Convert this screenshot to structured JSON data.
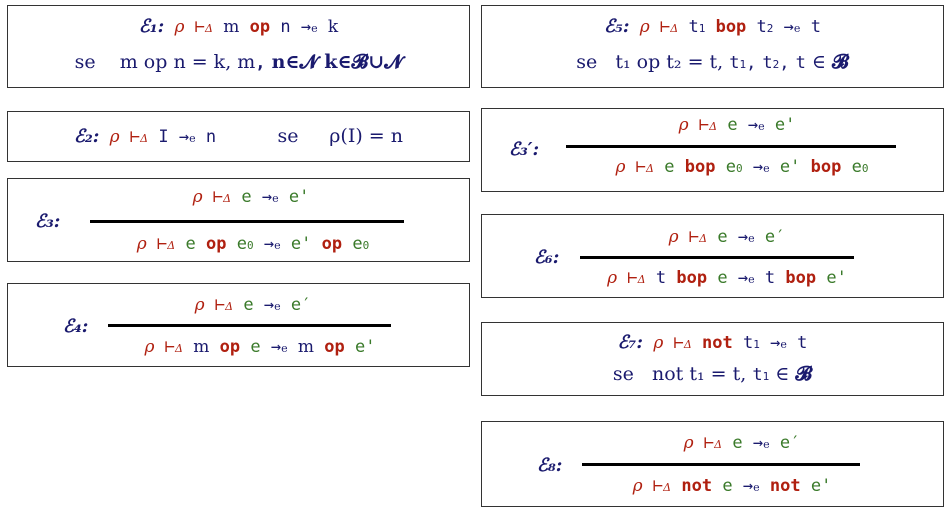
{
  "rules": {
    "e1": {
      "label": "ℰ₁:",
      "line1": {
        "rho": "ρ",
        "turnstile": "⊢",
        "delta": "Δ",
        "m": "m",
        "op": "op",
        "n": "n",
        "arrow": "→",
        "e": "e",
        "k": "k"
      },
      "line2": {
        "se": "se",
        "cond": "m op n = k, m",
        "comma": ",",
        "tail": "n∈𝓝  k∈𝓑∪𝓝"
      }
    },
    "e2": {
      "label": "ℰ₂:",
      "rho": "ρ",
      "turnstile": "⊢",
      "delta": "Δ",
      "I": "I",
      "arrow": "→",
      "e": "e",
      "n": "n",
      "se": "se",
      "cond": "ρ(I) = n"
    },
    "e3": {
      "label": "ℰ₃:",
      "premise": {
        "rho": "ρ",
        "turnstile": "⊢",
        "delta": "Δ",
        "e1": "e",
        "arrow": "→",
        "e": "e",
        "e2": "e'"
      },
      "concl": {
        "rho": "ρ",
        "turnstile": "⊢",
        "delta": "Δ",
        "e1": "e",
        "op": "op",
        "e0": "e",
        "zero": "0",
        "arrow": "→",
        "e": "e",
        "e2": "e'",
        "op2": "op",
        "e3": "e",
        "zero2": "0"
      }
    },
    "e4": {
      "label": "ℰ₄:",
      "premise": {
        "rho": "ρ",
        "turnstile": "⊢",
        "delta": "Δ",
        "e1": "e",
        "arrow": "→",
        "e": "e",
        "e2": "e′"
      },
      "concl": {
        "rho": "ρ",
        "turnstile": "⊢",
        "delta": "Δ",
        "m": "m",
        "op": "op",
        "e1": "e",
        "arrow": "→",
        "e": "e",
        "m2": "m",
        "op2": "op",
        "e2": "e'"
      }
    },
    "e5": {
      "label": "ℰ₅:",
      "line1": {
        "rho": "ρ",
        "turnstile": "⊢",
        "delta": "Δ",
        "t1": "t",
        "one": "1",
        "bop": "bop",
        "t2": "t",
        "two": "2",
        "arrow": "→",
        "e": "e",
        "t": "t"
      },
      "line2": {
        "se": "se",
        "cond": "t₁ op t₂ = t, ",
        "t1": "t",
        "one": "1",
        "c1": ",",
        "t2": "t",
        "two": "2",
        "c2": ",",
        "t": "t",
        "in": "∈",
        "B": "𝓑"
      }
    },
    "e3p": {
      "label": "ℰ₃′:",
      "premise": {
        "rho": "ρ",
        "turnstile": "⊢",
        "delta": "Δ",
        "e1": "e",
        "arrow": "→",
        "e": "e",
        "e2": "e'"
      },
      "concl": {
        "rho": "ρ",
        "turnstile": "⊢",
        "delta": "Δ",
        "e1": "e",
        "bop": "bop",
        "e0": "e",
        "zero": "0",
        "arrow": "→",
        "e": "e",
        "e2": "e'",
        "bop2": "bop",
        "e3": "e",
        "zero2": "0"
      }
    },
    "e6": {
      "label": "ℰ₆:",
      "premise": {
        "rho": "ρ",
        "turnstile": "⊢",
        "delta": "Δ",
        "e1": "e",
        "arrow": "→",
        "e": "e",
        "e2": "e′"
      },
      "concl": {
        "rho": "ρ",
        "turnstile": "⊢",
        "delta": "Δ",
        "t": "t",
        "bop": "bop",
        "e1": "e",
        "arrow": "→",
        "e": "e",
        "t2": "t",
        "bop2": "bop",
        "e2": "e'"
      }
    },
    "e7": {
      "label": "ℰ₇:",
      "line1": {
        "rho": "ρ",
        "turnstile": "⊢",
        "delta": "Δ",
        "not": "not",
        "t1": "t",
        "one": "1",
        "arrow": "→",
        "e": "e",
        "t": "t"
      },
      "line2": {
        "se": "se",
        "cond": "not t₁ = t, ",
        "t1": "t",
        "one": "1",
        "in": "∈",
        "B": "𝓑"
      }
    },
    "e8": {
      "label": "ℰ₈:",
      "premise": {
        "rho": "ρ",
        "turnstile": "⊢",
        "delta": "Δ",
        "e1": "e",
        "arrow": "→",
        "e": "e",
        "e2": "e′"
      },
      "concl": {
        "rho": "ρ",
        "turnstile": "⊢",
        "delta": "Δ",
        "not": "not",
        "e1": "e",
        "arrow": "→",
        "e": "e",
        "not2": "not",
        "e2": "e'"
      }
    }
  }
}
